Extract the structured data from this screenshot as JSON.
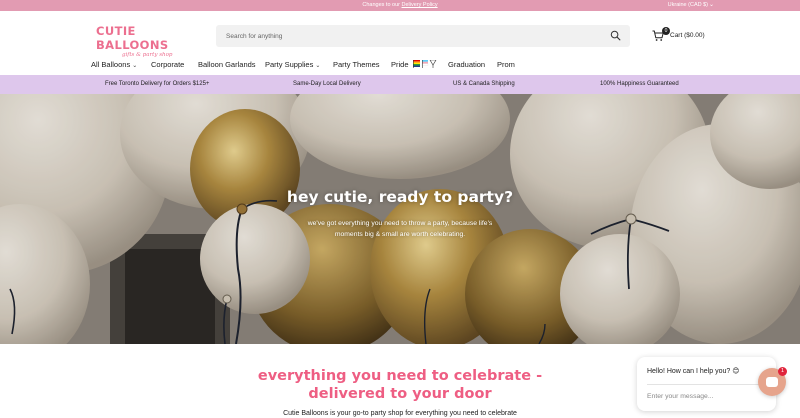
{
  "announcement": {
    "prefix": "Changes to our ",
    "link": "Delivery Policy",
    "locale": "Ukraine (CAD $)"
  },
  "header": {
    "brand": "CUTIE BALLOONS",
    "tagline": "gifts & party shop",
    "search_placeholder": "Search for anything",
    "cart_count": "0",
    "cart_label": "Cart ($0.00)"
  },
  "nav": {
    "items": [
      {
        "label": "All Balloons",
        "has_dropdown": true
      },
      {
        "label": "Corporate",
        "has_dropdown": false
      },
      {
        "label": "Balloon Garlands",
        "has_dropdown": false
      },
      {
        "label": "Party Supplies",
        "has_dropdown": true
      },
      {
        "label": "Party Themes",
        "has_dropdown": false
      },
      {
        "label": "Pride",
        "has_dropdown": false
      },
      {
        "label": "Graduation",
        "has_dropdown": false
      },
      {
        "label": "Prom",
        "has_dropdown": false
      }
    ]
  },
  "perks": [
    "Free Toronto Delivery for Orders $125+",
    "Same-Day Local Delivery",
    "US & Canada Shipping",
    "100% Happiness Guaranteed"
  ],
  "hero": {
    "headline": "hey cutie, ready to party?",
    "subline1": "we've got everything you need to throw a party, because life's",
    "subline2": "moments big & small are worth celebrating."
  },
  "section": {
    "title_line1": "everything you need to celebrate -",
    "title_line2": "delivered to your door",
    "blurb": "Cutie Balloons is your go-to party shop for everything you need to celebrate"
  },
  "chat": {
    "greeting": "Hello! How can I help you? 😊",
    "input_placeholder": "Enter your message...",
    "badge_count": "1"
  },
  "colors": {
    "brand_pink": "#ec6f8f",
    "announcement_bg": "#e29bb2",
    "perks_bg": "#dec7ec",
    "chat_button": "#e6a48c",
    "badge_red": "#e0243b"
  },
  "icons": [
    "search-icon",
    "cart-icon",
    "chevron-down-icon",
    "pride-flags-icon",
    "chat-icon"
  ]
}
